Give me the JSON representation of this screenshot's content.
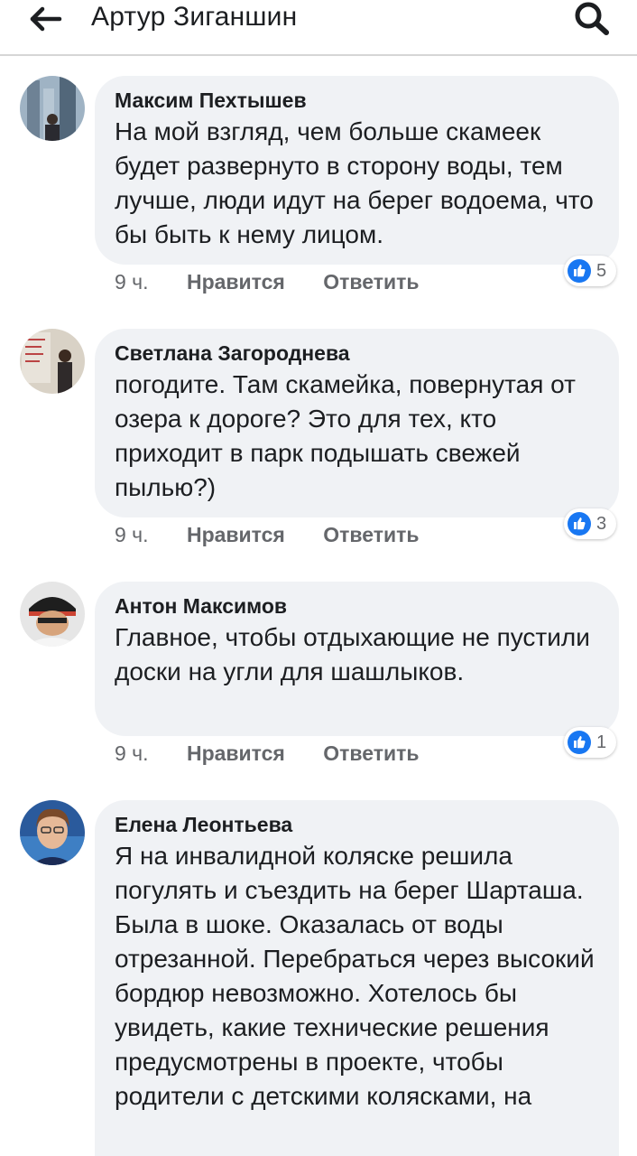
{
  "header": {
    "title": "Артур Зиганшин",
    "back_icon": "arrow-left-icon",
    "search_icon": "search-icon"
  },
  "colors": {
    "bubble": "#f0f2f5",
    "meta_text": "#65676b",
    "like_blue": "#1877f2"
  },
  "comments": [
    {
      "author": "Максим Пехтышев",
      "text": "На мой взгляд, чем больше скамеек будет развернуто в сторону воды, тем лучше, люди идут на берег водоема, что бы быть к нему лицом.",
      "time": "9 ч.",
      "like_label": "Нравится",
      "reply_label": "Ответить",
      "reactions": "5"
    },
    {
      "author": "Светлана Загороднева",
      "text": "погодите. Там скамейка, повернутая от озера к дороге? Это для тех, кто приходит в парк подышать свежей пылью?)",
      "time": "9 ч.",
      "like_label": "Нравится",
      "reply_label": "Ответить",
      "reactions": "3"
    },
    {
      "author": "Антон Максимов",
      "text": "Главное, чтобы отдыхающие не пустили доски на угли для шашлыков.",
      "time": "9 ч.",
      "like_label": "Нравится",
      "reply_label": "Ответить",
      "reactions": "1"
    },
    {
      "author": "Елена Леонтьева",
      "text": "Я на инвалидной коляске решила погулять и съездить на берег Шарташа. Была в шоке. Оказалась от воды отрезанной. Перебраться через высокий бордюр невозможно. Хотелось бы увидеть, какие технические решения предусмотрены в проекте, чтобы родители с детскими колясками, на"
    }
  ]
}
